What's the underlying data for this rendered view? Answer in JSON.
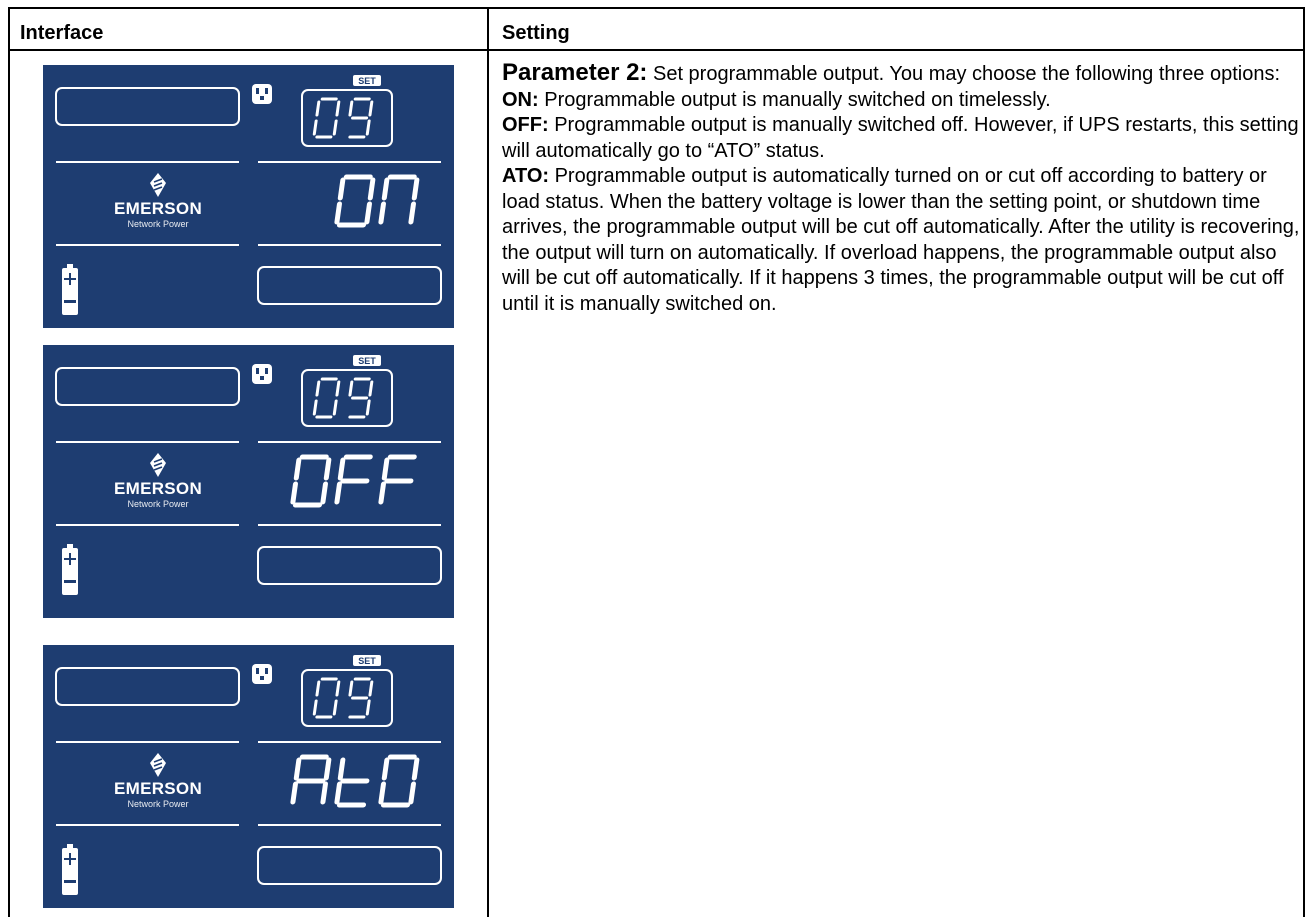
{
  "table": {
    "col_interface": "Interface",
    "col_setting": "Setting"
  },
  "panels": [
    {
      "brand": "EMERSON",
      "subbrand": "Network Power",
      "set_label": "SET",
      "code": "09",
      "value": "ON"
    },
    {
      "brand": "EMERSON",
      "subbrand": "Network Power",
      "set_label": "SET",
      "code": "09",
      "value": "OFF"
    },
    {
      "brand": "EMERSON",
      "subbrand": "Network Power",
      "set_label": "SET",
      "code": "09",
      "value": "AtO"
    }
  ],
  "setting": {
    "param_label": "Parameter 2:",
    "param_text": " Set programmable output. You may choose the following three options:",
    "on_label": "ON:",
    "on_text": " Programmable output is manually switched on timelessly.",
    "off_label": "OFF:",
    "off_text": " Programmable output is manually switched off. However, if UPS restarts, this setting will automatically go to “ATO” status.",
    "ato_label": "ATO:",
    "ato_text": " Programmable output is automatically turned on or cut off according to battery or load status. When the battery voltage is lower than the setting point, or shutdown time arrives, the programmable output will be cut off automatically. After the utility is recovering, the output will turn on automatically. If overload happens, the programmable output also will be cut off automatically. If it happens 3 times, the programmable output will be cut off until it is manually switched on."
  },
  "colors": {
    "panel_bg": "#1e3d71",
    "panel_fg": "#ffffff"
  }
}
